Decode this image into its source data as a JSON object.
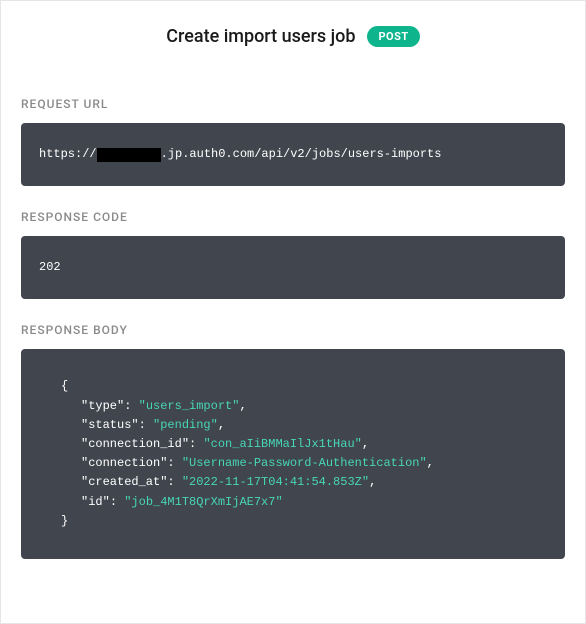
{
  "header": {
    "title": "Create import users job",
    "method": "POST"
  },
  "sections": {
    "request_url": {
      "label": "REQUEST URL",
      "url_prefix": "https://",
      "url_suffix": ".jp.auth0.com/api/v2/jobs/users-imports"
    },
    "response_code": {
      "label": "RESPONSE CODE",
      "value": "202"
    },
    "response_body": {
      "label": "RESPONSE BODY",
      "json": {
        "type_key": "\"type\"",
        "type_value": "\"users_import\"",
        "status_key": "\"status\"",
        "status_value": "\"pending\"",
        "connection_id_key": "\"connection_id\"",
        "connection_id_value": "\"con_aIiBMMaIlJx1tHau\"",
        "connection_key": "\"connection\"",
        "connection_value": "\"Username-Password-Authentication\"",
        "created_at_key": "\"created_at\"",
        "created_at_value": "\"2022-11-17T04:41:54.853Z\"",
        "id_key": "\"id\"",
        "id_value": "\"job_4M1T8QrXmIjAE7x7\""
      }
    }
  }
}
